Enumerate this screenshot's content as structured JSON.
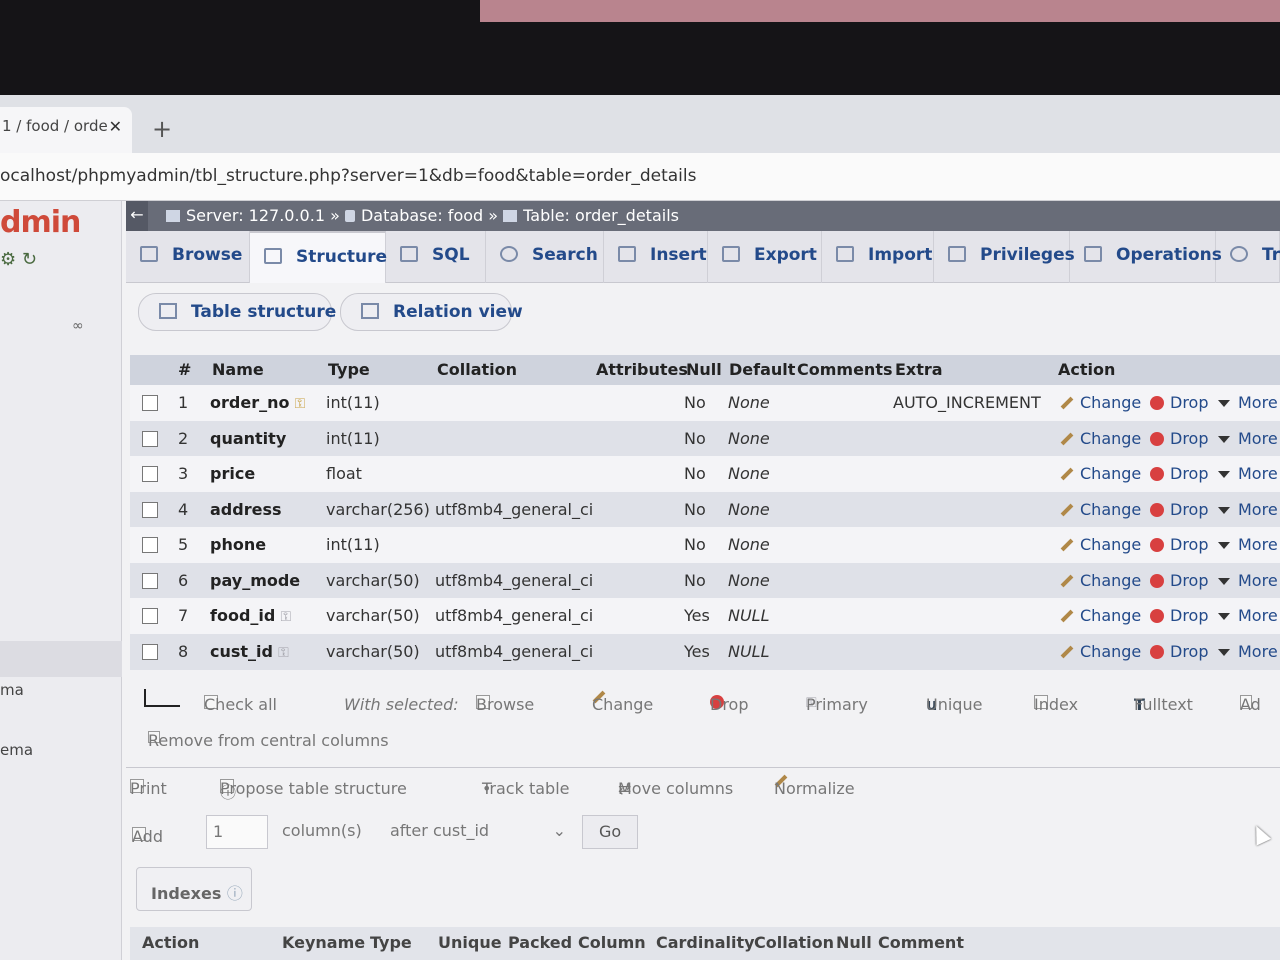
{
  "browser": {
    "tab_title": "1 / food / orde",
    "tab_close": "✕",
    "new_tab": "+",
    "url": "ocalhost/phpmyadmin/tbl_structure.php?server=1&db=food&table=order_details"
  },
  "nav": {
    "logo": "dmin",
    "icons": "⚙ ↻",
    "items": [
      "ma",
      "ema"
    ]
  },
  "breadcrumb": {
    "collapse": "←",
    "server": "Server: 127.0.0.1",
    "sep": "»",
    "database": "Database: food",
    "table": "Table: order_details"
  },
  "tabs": [
    "Browse",
    "Structure",
    "SQL",
    "Search",
    "Insert",
    "Export",
    "Import",
    "Privileges",
    "Operations",
    "Tra"
  ],
  "subtabs": [
    "Table structure",
    "Relation view"
  ],
  "structure": {
    "headers": {
      "num": "#",
      "name": "Name",
      "type": "Type",
      "collation": "Collation",
      "attributes": "Attributes",
      "null": "Null",
      "default": "Default",
      "comments": "Comments",
      "extra": "Extra",
      "action": "Action"
    },
    "rows": [
      {
        "num": "1",
        "name": "order_no",
        "type": "int(11)",
        "collation": "",
        "null": "No",
        "default": "None",
        "extra": "AUTO_INCREMENT"
      },
      {
        "num": "2",
        "name": "quantity",
        "type": "int(11)",
        "collation": "",
        "null": "No",
        "default": "None",
        "extra": ""
      },
      {
        "num": "3",
        "name": "price",
        "type": "float",
        "collation": "",
        "null": "No",
        "default": "None",
        "extra": ""
      },
      {
        "num": "4",
        "name": "address",
        "type": "varchar(256)",
        "collation": "utf8mb4_general_ci",
        "null": "No",
        "default": "None",
        "extra": ""
      },
      {
        "num": "5",
        "name": "phone",
        "type": "int(11)",
        "collation": "",
        "null": "No",
        "default": "None",
        "extra": ""
      },
      {
        "num": "6",
        "name": "pay_mode",
        "type": "varchar(50)",
        "collation": "utf8mb4_general_ci",
        "null": "No",
        "default": "None",
        "extra": ""
      },
      {
        "num": "7",
        "name": "food_id",
        "type": "varchar(50)",
        "collation": "utf8mb4_general_ci",
        "null": "Yes",
        "default": "NULL",
        "extra": ""
      },
      {
        "num": "8",
        "name": "cust_id",
        "type": "varchar(50)",
        "collation": "utf8mb4_general_ci",
        "null": "Yes",
        "default": "NULL",
        "extra": ""
      }
    ],
    "actions": {
      "change": "Change",
      "drop": "Drop",
      "more": "More"
    }
  },
  "bulk": {
    "check_all": "Check all",
    "with_selected": "With selected:",
    "browse": "Browse",
    "change": "Change",
    "drop": "Drop",
    "primary": "Primary",
    "unique": "Unique",
    "index": "Index",
    "fulltext": "Fulltext",
    "ad": "Ad",
    "remove_central": "Remove from central columns"
  },
  "tools": {
    "print": "Print",
    "propose": "Propose table structure",
    "track": "Track table",
    "move": "Move columns",
    "normalize": "Normalize"
  },
  "add": {
    "label": "Add",
    "count": "1",
    "columns": "column(s)",
    "after": "after cust_id",
    "go": "Go"
  },
  "indexes": {
    "legend": "Indexes",
    "headers": [
      "Action",
      "Keyname",
      "Type",
      "Unique",
      "Packed",
      "Column",
      "Cardinality",
      "Collation",
      "Null",
      "Comment"
    ]
  }
}
